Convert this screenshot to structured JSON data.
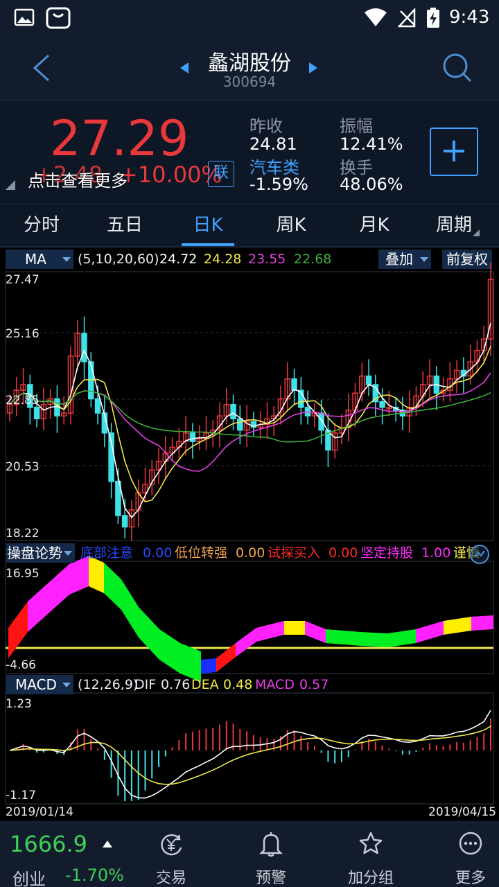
{
  "status_bar": {
    "time": "9:43"
  },
  "header": {
    "stock_name": "蠡湖股份",
    "stock_code": "300694"
  },
  "quote": {
    "price": "27.29",
    "change": "+2.48",
    "change_pct": "+10.00%",
    "link_badge": "联",
    "overlay_text": "点击查看更多",
    "prev_close_label": "昨收",
    "prev_close": "24.81",
    "amplitude_label": "振幅",
    "amplitude": "12.41%",
    "sector_label": "汽车类",
    "sector_change": "-1.59%",
    "turnover_label": "换手",
    "turnover": "48.06%",
    "add_button": "+"
  },
  "tabs": [
    "分时",
    "五日",
    "日K",
    "周K",
    "月K",
    "周期"
  ],
  "ma_bar": {
    "indicator": "MA",
    "params": "(5,10,20,60)",
    "values": [
      "24.72",
      "24.28",
      "23.55",
      "22.68"
    ],
    "overlay_btn": "叠加",
    "adjust_btn": "前复权"
  },
  "signal_bar": {
    "indicator": "操盘论势",
    "items": [
      {
        "name": "底部注意",
        "value": "0.00"
      },
      {
        "name": "低位转强",
        "value": "0.00"
      },
      {
        "name": "试探买入",
        "value": "0.00"
      },
      {
        "name": "坚定持股",
        "value": "1.00"
      },
      {
        "name": "谨慎",
        "value": ""
      }
    ]
  },
  "macd_bar": {
    "indicator": "MACD",
    "params": "(12,26,9)",
    "dif_label": "DIF",
    "dif": "0.76",
    "dea_label": "DEA",
    "dea": "0.48",
    "macd_label": "MACD",
    "macd": "0.57"
  },
  "dates": {
    "start": "2019/01/14",
    "end": "2019/04/15"
  },
  "bottom": {
    "index_value": "1666.9",
    "index_name": "创业",
    "index_change": "-1.70%",
    "nav": [
      "交易",
      "预警",
      "加分组",
      "更多"
    ]
  },
  "colors": {
    "up": "#e8383c",
    "down": "#3fe0e8",
    "ma5": "#ffffff",
    "ma10": "#f2e94e",
    "ma20": "#e540e5",
    "ma60": "#3fae3a",
    "accent": "#3fa2ff",
    "green_text": "#3fcf5a"
  },
  "chart_data": [
    {
      "type": "candlestick",
      "y_axis_ticks": [
        "27.47",
        "25.16",
        "22.85",
        "20.53",
        "18.22"
      ],
      "ylim": [
        18.22,
        27.47
      ],
      "last_close": 27.29,
      "ma_last": {
        "ma5": 24.72,
        "ma10": 24.28,
        "ma20": 23.55,
        "ma60": 22.68
      }
    },
    {
      "type": "area",
      "title": "操盘论势",
      "y_axis_ticks": [
        "16.95",
        "-4.66"
      ],
      "ylim": [
        -4.66,
        16.95
      ]
    },
    {
      "type": "bar",
      "title": "MACD",
      "y_axis_ticks": [
        "1.23",
        "-1.17"
      ],
      "ylim": [
        -1.17,
        1.23
      ],
      "last": {
        "dif": 0.76,
        "dea": 0.48,
        "macd": 0.57
      }
    }
  ]
}
